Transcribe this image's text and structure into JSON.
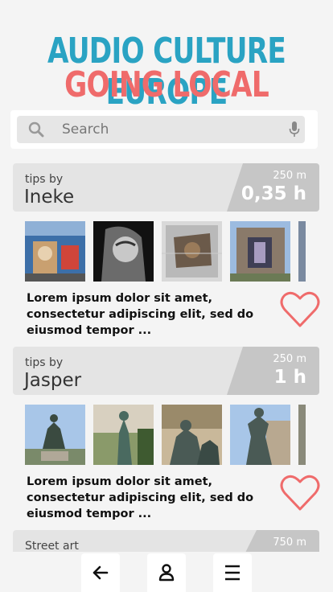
{
  "header": {
    "title_line1": "AUDIO CULTURE EUROPE",
    "title_line2": "GOING LOCAL"
  },
  "search": {
    "placeholder": "Search",
    "value": ""
  },
  "cards": [
    {
      "subtitle": "tips by",
      "name": "Ineke",
      "distance": "250 m",
      "duration": "0,35 h",
      "description": "Lorem ipsum dolor sit amet, consectetur adipiscing elit, sed do eiusmod tempor ...",
      "liked": false
    },
    {
      "subtitle": "tips by",
      "name": "Jasper",
      "distance": "250 m",
      "duration": "1 h",
      "description": "Lorem ipsum dolor sit amet, consectetur adipiscing elit, sed do eiusmod tempor ...",
      "liked": false
    },
    {
      "subtitle": "Street art",
      "distance": "750 m"
    }
  ],
  "colors": {
    "title1": "#2aa3c3",
    "title2": "#ef6b6b",
    "heart": "#ef6b6b",
    "badge": "#c6c6c6"
  },
  "bottom_nav": {
    "icons": [
      "arrow-left-icon",
      "user-icon",
      "menu-icon"
    ]
  }
}
